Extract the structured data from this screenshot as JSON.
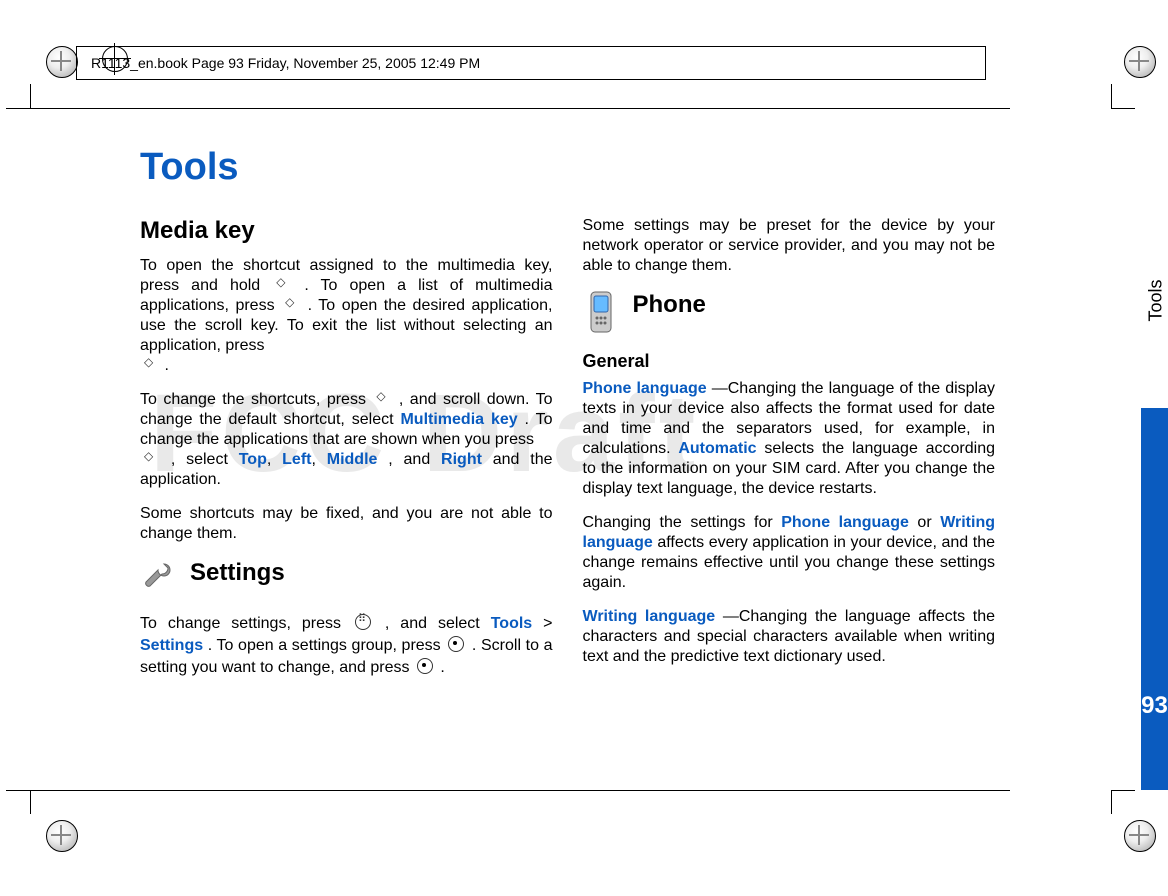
{
  "header": {
    "text": "R1113_en.book  Page 93  Friday, November 25, 2005  12:49 PM"
  },
  "watermark": "FCC Draft",
  "sidetab": {
    "label": "Tools",
    "page": "93"
  },
  "left": {
    "title": "Tools",
    "h_mediakey": "Media key",
    "p1_a": "To open the shortcut assigned to the multimedia key, press and hold ",
    "p1_b": ". To open a list of multimedia applications, press ",
    "p1_c": ". To open the desired application, use the scroll key. To exit the list without selecting an application, press ",
    "p1_d": ".",
    "p2_a": "To change the shortcuts, press ",
    "p2_b": ", and scroll down. To change the default shortcut, select ",
    "p2_multimedia": "Multimedia key",
    "p2_c": ". To change the applications that are shown when you press ",
    "p2_d": ", select ",
    "p2_top": "Top",
    "p2_left": "Left",
    "p2_middle": "Middle",
    "p2_and": ", and ",
    "p2_right": "Right",
    "p2_e": " and the application.",
    "p3": "Some shortcuts may be fixed, and you are not able to change them.",
    "h_settings": "Settings",
    "p4_a": "To change settings, press ",
    "p4_b": ", and select ",
    "p4_tools": "Tools",
    "p4_gt": " > ",
    "p4_settings": "Settings",
    "p4_c": ". To open a settings group, press ",
    "p4_d": ". Scroll to a setting you want to change, and press ",
    "p4_e": "."
  },
  "right": {
    "p1": "Some settings may be preset for the device by your network operator or service provider, and you may not be able to change them.",
    "h_phone": "Phone",
    "h_general": "General",
    "p2_phonelang": "Phone language",
    "p2_a": "—Changing the language of the display texts in your device also affects the format used for date and time and the separators used, for example, in calculations. ",
    "p2_auto": "Automatic",
    "p2_b": " selects the language according to the information on your SIM card. After you change the display text language, the device restarts.",
    "p3_a": "Changing the settings for ",
    "p3_phonelang": "Phone language",
    "p3_or": " or ",
    "p3_writinglang": "Writing language",
    "p3_b": " affects every application in your device, and the change remains effective until you change these settings again.",
    "p4_writinglang": "Writing language",
    "p4_a": "—Changing the language affects the characters and special characters available when writing text and the predictive text dictionary used."
  }
}
